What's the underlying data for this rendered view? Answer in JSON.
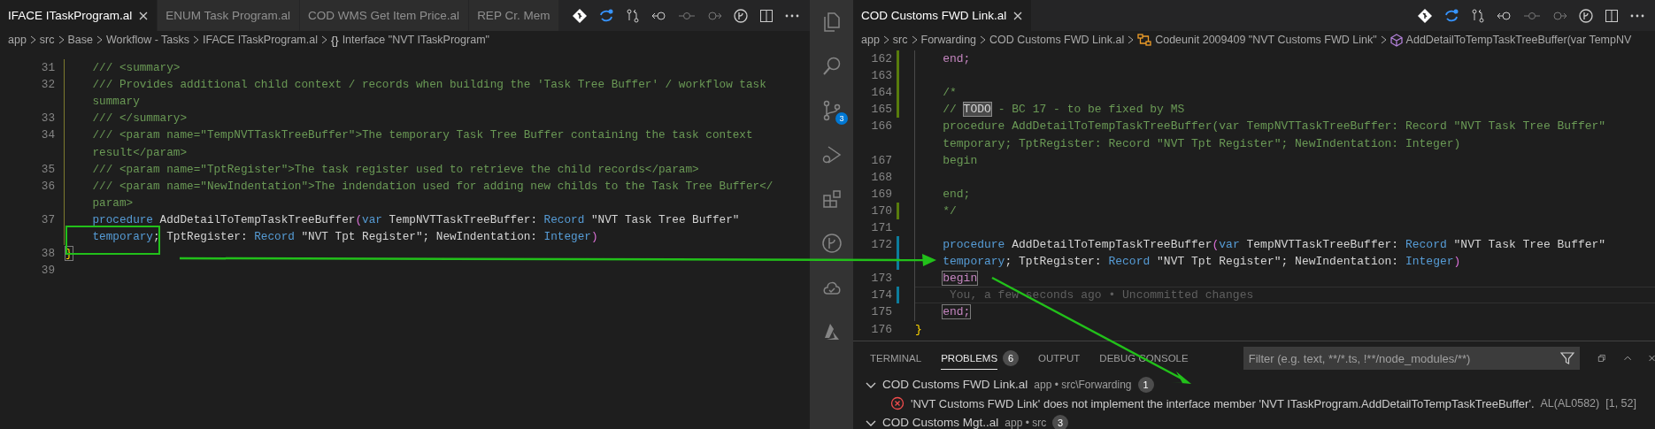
{
  "left_editor": {
    "tabs": [
      {
        "label": "IFACE ITaskProgram.al",
        "selected": true
      },
      {
        "label": "ENUM Task Program.al",
        "selected": false
      },
      {
        "label": "COD WMS Get Item Price.al",
        "selected": false
      },
      {
        "label": "REP Cr. Mem",
        "selected": false
      }
    ],
    "breadcrumbs": [
      {
        "label": "app"
      },
      {
        "label": "src"
      },
      {
        "label": "Base"
      },
      {
        "label": "Workflow - Tasks"
      },
      {
        "label": "IFACE ITaskProgram.al"
      },
      {
        "glyph": "{}",
        "label": "Interface \"NVT ITaskProgram\""
      }
    ],
    "lines": [
      {
        "number": "31",
        "guide": true,
        "tokens": [
          {
            "kind": "comment",
            "text": "    /// <summary>"
          }
        ]
      },
      {
        "number": "32",
        "guide": true,
        "tokens": [
          {
            "kind": "comment",
            "text": "    /// Provides additional child context / records when building the 'Task Tree Buffer' / workflow task"
          }
        ]
      },
      {
        "guide": true,
        "tokens": [
          {
            "kind": "comment",
            "text": "    summary"
          }
        ]
      },
      {
        "number": "33",
        "guide": true,
        "tokens": [
          {
            "kind": "comment",
            "text": "    /// </summary>"
          }
        ]
      },
      {
        "number": "34",
        "guide": true,
        "tokens": [
          {
            "kind": "comment",
            "text": "    /// <param name=\"TempNVTTaskTreeBuffer\">The temporary Task Tree Buffer containing the task context"
          }
        ]
      },
      {
        "guide": true,
        "tokens": [
          {
            "kind": "comment",
            "text": "    result</param>"
          }
        ]
      },
      {
        "number": "35",
        "guide": true,
        "tokens": [
          {
            "kind": "comment",
            "text": "    /// <param name=\"TptRegister\">The task register used to retrieve the child records</param>"
          }
        ]
      },
      {
        "number": "36",
        "guide": true,
        "tokens": [
          {
            "kind": "comment",
            "text": "    /// <param name=\"NewIndentation\">The indendation used for adding new childs to the Task Tree Buffer</"
          }
        ]
      },
      {
        "guide": true,
        "tokens": [
          {
            "kind": "comment",
            "text": "    param>"
          }
        ]
      },
      {
        "number": "37",
        "guide": true,
        "tokens": [
          {
            "kind": "keyword",
            "text": "    procedure"
          },
          {
            "kind": "plain",
            "text": " AddDetailToTempTaskTreeBuffer"
          },
          {
            "kind": "bracket",
            "text": "("
          },
          {
            "kind": "keyword",
            "text": "var"
          },
          {
            "kind": "plain",
            "text": " TempNVTTaskTreeBuffer: "
          },
          {
            "kind": "keyword",
            "text": "Record"
          },
          {
            "kind": "plain",
            "text": " \"NVT Task Tree Buffer\""
          }
        ]
      },
      {
        "guide": true,
        "tokens": [
          {
            "kind": "keyword",
            "text": "    temporary"
          },
          {
            "kind": "plain",
            "text": "; TptRegister: "
          },
          {
            "kind": "keyword",
            "text": "Record"
          },
          {
            "kind": "plain",
            "text": " \"NVT Tpt Register\"; NewIndentation: "
          },
          {
            "kind": "keyword",
            "text": "Integer"
          },
          {
            "kind": "bracket",
            "text": ")"
          }
        ]
      },
      {
        "number": "38",
        "tokens": [
          {
            "kind": "brace-match",
            "text": "}"
          }
        ]
      },
      {
        "number": "39"
      }
    ]
  },
  "activity_bar": {
    "items": [
      {
        "kind": "files"
      },
      {
        "kind": "search"
      },
      {
        "kind": "source-control",
        "badge": "3"
      },
      {
        "kind": "run"
      },
      {
        "kind": "extensions"
      },
      {
        "kind": "graph"
      },
      {
        "kind": "cloud"
      },
      {
        "kind": "azure"
      }
    ]
  },
  "right_editor": {
    "tabs": [
      {
        "label": "COD Customs FWD Link.al",
        "selected": true
      }
    ],
    "breadcrumbs": [
      {
        "label": "app"
      },
      {
        "label": "src"
      },
      {
        "label": "Forwarding"
      },
      {
        "label": "COD Customs FWD Link.al"
      },
      {
        "kind": "codeunit",
        "label": "Codeunit 2009409 \"NVT Customs FWD Link\""
      },
      {
        "kind": "method",
        "label": "AddDetailToTempTaskTreeBuffer(var TempNV"
      }
    ],
    "lines": [
      {
        "number": "162",
        "added": true,
        "guide": true,
        "tokens": [
          {
            "kind": "control",
            "text": "    end;"
          }
        ]
      },
      {
        "number": "163",
        "added": true,
        "guide": true
      },
      {
        "number": "164",
        "added": true,
        "guide": true,
        "tokens": [
          {
            "kind": "comment",
            "text": "    /*"
          }
        ]
      },
      {
        "number": "165",
        "added": true,
        "guide": true,
        "tokens": [
          {
            "kind": "comment",
            "text": "    // "
          },
          {
            "kind": "todo",
            "text": "TODO"
          },
          {
            "kind": "comment",
            "text": " - BC 17 - to be fixed by MS"
          }
        ]
      },
      {
        "number": "166",
        "guide": true,
        "tokens": [
          {
            "kind": "comment",
            "text": "    procedure AddDetailToTempTaskTreeBuffer(var TempNVTTaskTreeBuffer: Record \"NVT Task Tree Buffer\""
          }
        ]
      },
      {
        "guide": true,
        "tokens": [
          {
            "kind": "comment",
            "text": "    temporary; TptRegister: Record \"NVT Tpt Register\"; NewIndentation: Integer)"
          }
        ]
      },
      {
        "number": "167",
        "guide": true,
        "tokens": [
          {
            "kind": "comment",
            "text": "    begin"
          }
        ]
      },
      {
        "number": "168",
        "guide": true
      },
      {
        "number": "169",
        "guide": true,
        "tokens": [
          {
            "kind": "comment",
            "text": "    end;"
          }
        ]
      },
      {
        "number": "170",
        "added": true,
        "guide": true,
        "tokens": [
          {
            "kind": "comment",
            "text": "    */"
          }
        ]
      },
      {
        "number": "171",
        "guide": true
      },
      {
        "number": "172",
        "modified": true,
        "guide": true,
        "tokens": [
          {
            "kind": "keyword",
            "text": "    procedure"
          },
          {
            "kind": "plain",
            "text": " AddDetailToTempTaskTreeBuffer"
          },
          {
            "kind": "bracket",
            "text": "("
          },
          {
            "kind": "keyword",
            "text": "var"
          },
          {
            "kind": "plain",
            "text": " TempNVTTaskTreeBuffer: "
          },
          {
            "kind": "keyword",
            "text": "Record"
          },
          {
            "kind": "plain",
            "text": " \"NVT Task Tree Buffer\""
          }
        ]
      },
      {
        "modified": true,
        "guide": true,
        "tokens": [
          {
            "kind": "keyword",
            "text": "    temporary"
          },
          {
            "kind": "plain",
            "text": "; TptRegister: "
          },
          {
            "kind": "keyword",
            "text": "Record"
          },
          {
            "kind": "plain",
            "text": " \"NVT Tpt Register\"; NewIndentation: "
          },
          {
            "kind": "keyword",
            "text": "Integer"
          },
          {
            "kind": "bracket",
            "text": ")"
          }
        ]
      },
      {
        "number": "173",
        "guide": true,
        "tokens": [
          {
            "kind": "control-match",
            "text": "    begin"
          }
        ]
      },
      {
        "number": "174",
        "modified": true,
        "guide": true,
        "current": true,
        "tokens": [
          {
            "kind": "blame",
            "text": "You, a few seconds ago • Uncommitted changes"
          }
        ]
      },
      {
        "number": "175",
        "guide": true,
        "tokens": [
          {
            "kind": "control-match",
            "text": "    end;"
          }
        ]
      },
      {
        "number": "176",
        "tokens": [
          {
            "kind": "brace",
            "text": "}"
          }
        ]
      }
    ]
  },
  "panel": {
    "tabs": [
      {
        "label": "TERMINAL",
        "selected": false
      },
      {
        "label": "PROBLEMS",
        "selected": true,
        "badge": "6"
      },
      {
        "label": "OUTPUT",
        "selected": false
      },
      {
        "label": "DEBUG CONSOLE",
        "selected": false
      }
    ],
    "filter": {
      "placeholder": "Filter (e.g. text, **/*.ts, !**/node_modules/**)"
    },
    "groups": [
      {
        "file": "COD Customs FWD Link.al",
        "path": "app • src\\Forwarding",
        "count": "1",
        "expanded": true,
        "problems": [
          {
            "message": "'NVT Customs FWD Link' does not implement the interface member 'NVT ITaskProgram.AddDetailToTempTaskTreeBuffer'.",
            "code": "AL(AL0582)",
            "position": "[1, 52]"
          }
        ]
      },
      {
        "file": "COD Customs Mgt..al",
        "path": "app • src",
        "count": "3",
        "expanded": true
      }
    ]
  },
  "annotations": [
    {
      "kind": "box"
    },
    {
      "kind": "arrow"
    },
    {
      "kind": "arrow"
    }
  ]
}
